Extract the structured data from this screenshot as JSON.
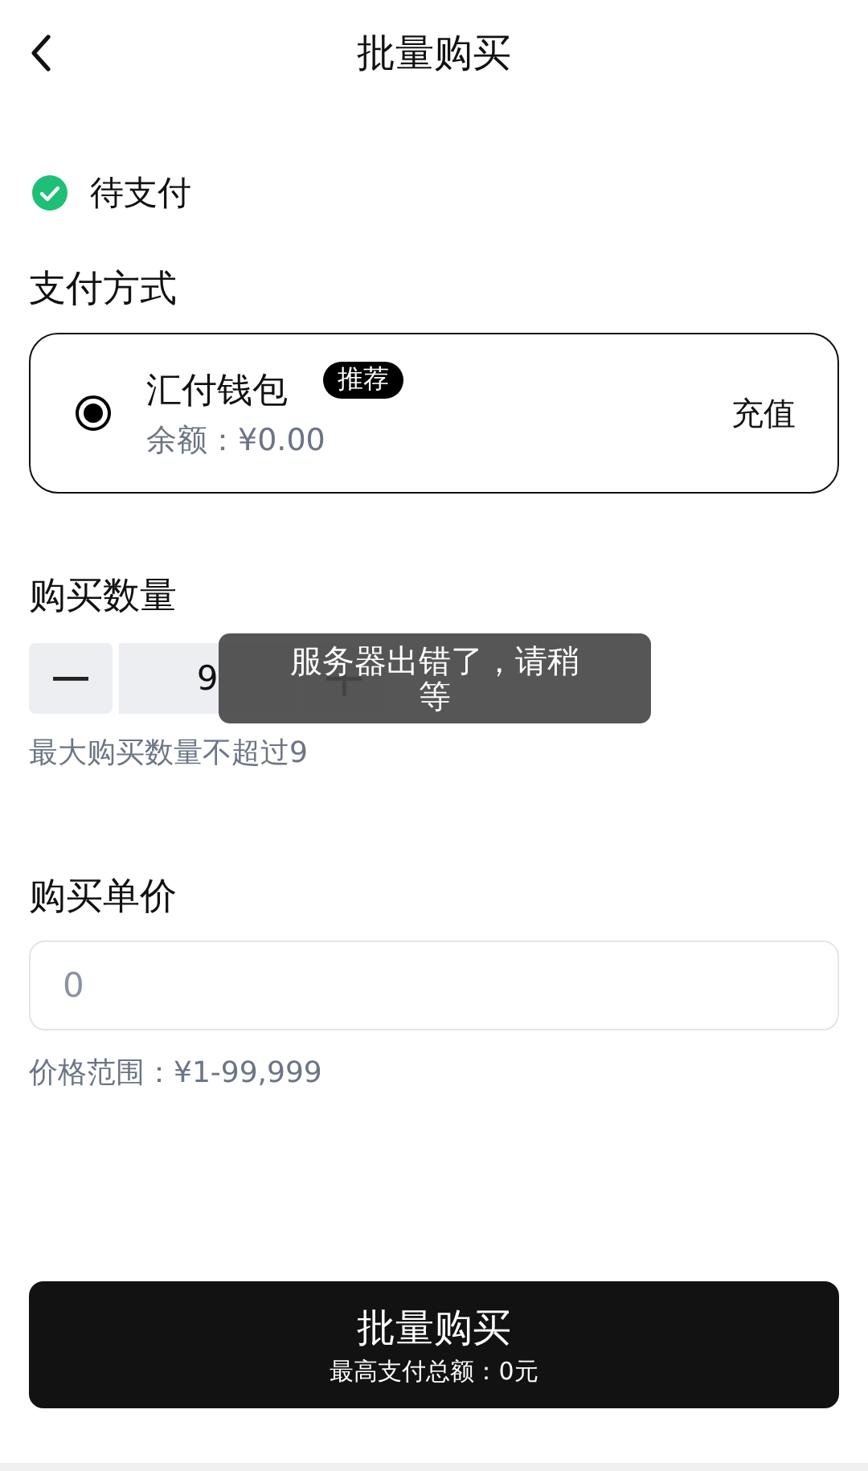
{
  "header": {
    "title": "批量购买"
  },
  "status": {
    "label": "待支付",
    "done": true
  },
  "payment": {
    "heading": "支付方式",
    "methods": [
      {
        "name": "汇付钱包",
        "badge": "推荐",
        "balance": "余额：¥0.00",
        "action": "充值",
        "selected": true
      }
    ]
  },
  "quantity": {
    "heading": "购买数量",
    "value": "9",
    "hint": "最大购买数量不超过9"
  },
  "price": {
    "heading": "购买单价",
    "placeholder": "0",
    "hint": "价格范围：¥1-99,999"
  },
  "submit": {
    "label": "批量购买",
    "sublabel": "最高支付总额：0元"
  },
  "toast": {
    "message": "服务器出错了，请稍等"
  }
}
